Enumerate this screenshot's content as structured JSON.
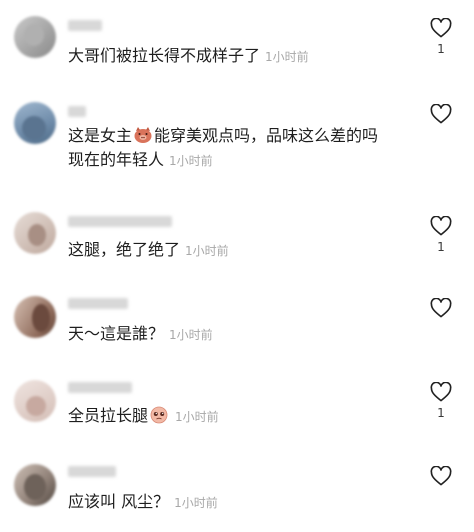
{
  "comments": [
    {
      "text": "大哥们被拉长得不成样子了",
      "time": "1小时前",
      "likes": "1",
      "emoji": null
    },
    {
      "text_before": "这是女主",
      "emoji": "pig-face-emoji",
      "text_after": "能穿美观点吗，品味这么差的吗",
      "text_line2": "现在的年轻人",
      "time": "1小时前",
      "likes": ""
    },
    {
      "text": "这腿，绝了绝了",
      "time": "1小时前",
      "likes": "1",
      "emoji": null
    },
    {
      "text": "天～這是誰？",
      "time": "1小时前",
      "likes": "",
      "emoji": null
    },
    {
      "text_before": "全员拉长腿",
      "emoji": "pleading-face-emoji",
      "time": "1小时前",
      "likes": "1"
    },
    {
      "text": "应该叫 风尘？",
      "time": "1小时前",
      "likes": "",
      "emoji": null
    }
  ],
  "icons": {
    "like": "heart-outline-icon"
  },
  "colors": {
    "text": "#1e1e1e",
    "time": "#a8a8a8",
    "heart": "#222222"
  }
}
